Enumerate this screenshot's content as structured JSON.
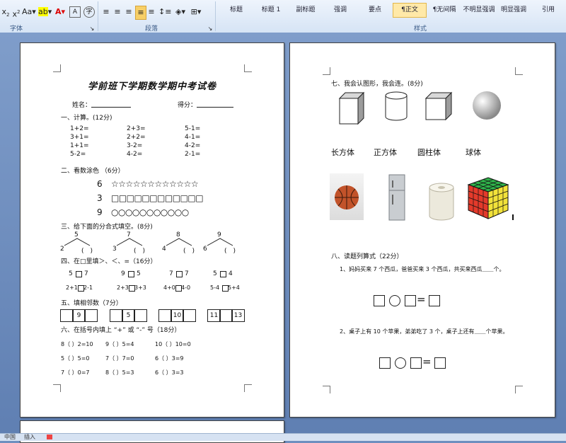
{
  "ribbon": {
    "font_group_label": "字体",
    "paragraph_group_label": "段落",
    "styles_group_label": "样式",
    "styles": [
      "标题",
      "标题 1",
      "副标题",
      "强调",
      "要点",
      "正文",
      "无间隔",
      "不明显强调",
      "明显强调",
      "引用"
    ],
    "selected_style": "正文"
  },
  "page1": {
    "title": "学前班下学期数学期中考试卷",
    "name_label": "姓名：",
    "score_label": "得分：",
    "section1": {
      "heading": "一、计算。(12分)",
      "col1": [
        "1+2=",
        "3+1=",
        "1+1=",
        "5-2="
      ],
      "col2": [
        "2+3=",
        "2+2=",
        "3-2=",
        "4-2="
      ],
      "col3": [
        "5-1=",
        "4-1=",
        "4-2=",
        "2-1="
      ]
    },
    "section2": {
      "heading": "二、看数涂色 （6分）",
      "rows": [
        {
          "num": "6",
          "shapes": "☆☆☆☆☆☆☆☆☆☆☆☆"
        },
        {
          "num": "3",
          "shapes": "□□□□□□□□□□□□"
        },
        {
          "num": "9",
          "shapes": "○○○○○○○○○○○"
        }
      ]
    },
    "section3": {
      "heading": "三、给下面的分合式填空。(8分)",
      "trees": [
        {
          "top": "5",
          "left": "2",
          "right": "(　)"
        },
        {
          "top": "7",
          "left": "3",
          "right": "(　)"
        },
        {
          "top": "8",
          "left": "4",
          "right": "(　)"
        },
        {
          "top": "9",
          "left": "6",
          "right": "(　)"
        }
      ]
    },
    "section4": {
      "heading": "四、在□里填＞、＜、=（16分）",
      "row1": [
        {
          "l": "5",
          "r": "7"
        },
        {
          "l": "9",
          "r": "5"
        },
        {
          "l": "7",
          "r": "7"
        },
        {
          "l": "5",
          "r": "4"
        }
      ],
      "row2": [
        {
          "l": "2+1",
          "r": "2-1"
        },
        {
          "l": "2+3",
          "r": "3+3"
        },
        {
          "l": "4+0",
          "r": "4-0"
        },
        {
          "l": "5-4",
          "r": "5+4"
        }
      ]
    },
    "section5": {
      "heading": "五、填相邻数（7分）",
      "groups": [
        {
          "values": [
            "",
            "9",
            ""
          ]
        },
        {
          "values": [
            "",
            "5",
            ""
          ]
        },
        {
          "values": [
            "",
            "10",
            ""
          ]
        },
        {
          "values": [
            "11",
            "",
            "13"
          ]
        }
      ]
    },
    "section6": {
      "heading": "六、在括号内填上 “+” 或 “-” 号（18分）",
      "rows": [
        [
          "8（ ）2=10",
          "9（ ）5=4",
          "10（ ）10=0"
        ],
        [
          "5（ ）5=0",
          "7（ ）7=0",
          "6（ ）3=9"
        ],
        [
          "7（ ）0=7",
          "8（ ）5=3",
          "6（ ）3=3"
        ]
      ]
    }
  },
  "page2": {
    "section7": {
      "heading": "七、我会认图形，我会连。(8分)",
      "labels": [
        "长方体",
        "正方体",
        "圆柱体",
        "球体"
      ]
    },
    "section8": {
      "heading": "八、读题列算式（22分）",
      "q1": "1、妈妈买来 7 个西瓜，爸爸买来 3 个西瓜，共买来西瓜＿＿个。",
      "q2": "2、桌子上有 10 个苹果，弟弟吃了 3 个，桌子上还有＿＿个苹果。",
      "equals": "="
    }
  },
  "status": {
    "left": "中国",
    "mid": "插入"
  },
  "colors": {
    "workspace": "#6e8fbf",
    "ribbon": "#dbe7f6",
    "selected_style": "#ffe9a8",
    "basketball": "#c2532a",
    "cube_green": "#2fb34a",
    "cube_red": "#e43a2b",
    "cube_yellow": "#f2e23a"
  }
}
